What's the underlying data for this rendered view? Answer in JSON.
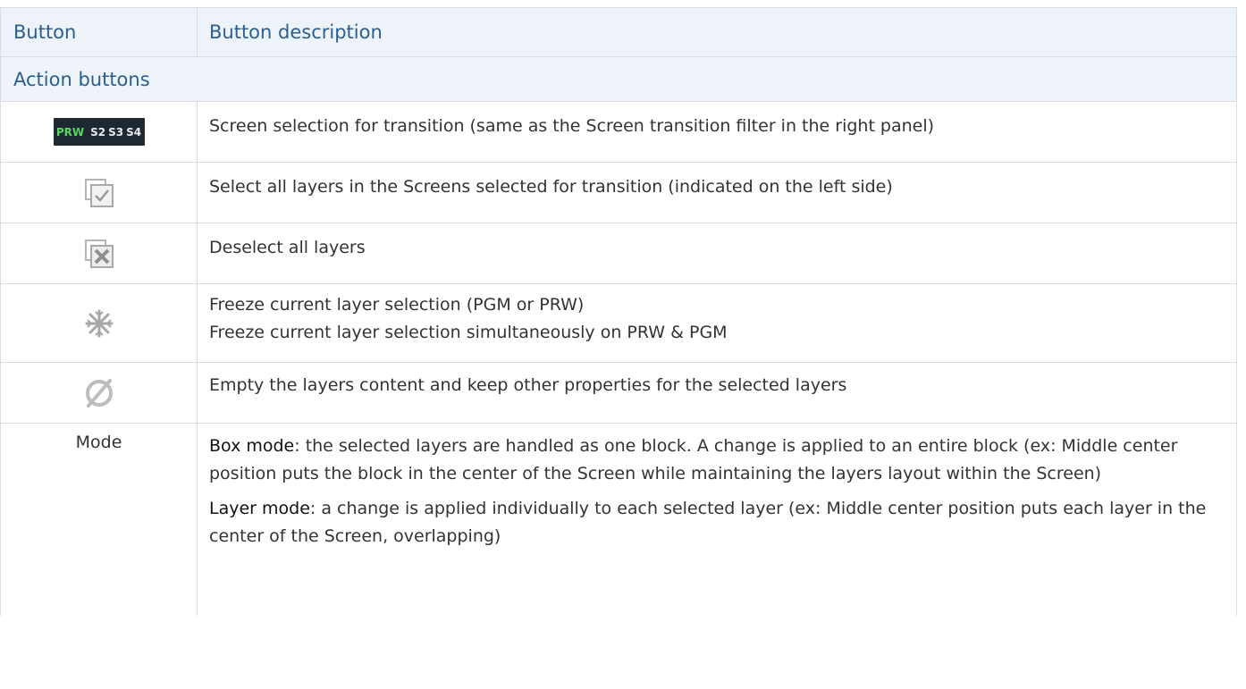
{
  "header": {
    "col1": "Button",
    "col2": "Button description"
  },
  "section": {
    "title": "Action buttons"
  },
  "rows": {
    "screen_sel": {
      "badge": {
        "prw": "PRW",
        "s2": "S2",
        "s3": "S3",
        "s4": "S4"
      },
      "desc": "Screen selection for transition (same as the Screen transition filter in the right panel)"
    },
    "select_all": {
      "icon": "select-all-layers-icon",
      "desc": "Select all layers in the Screens selected for transition (indicated on the left side)"
    },
    "deselect_all": {
      "icon": "deselect-all-layers-icon",
      "desc": "Deselect all layers"
    },
    "freeze": {
      "icon": "snowflake-icon",
      "desc1": "Freeze current layer selection (PGM or PRW)",
      "desc2": "Freeze current layer selection simultaneously on PRW & PGM"
    },
    "empty": {
      "icon": "empty-set-icon",
      "desc": "Empty the layers content and keep other properties for the selected layers"
    },
    "mode": {
      "label": "Mode",
      "box_term": "Box mode",
      "box_desc": ": the selected layers are handled as one block. A change is applied to an entire block (ex: Middle center position puts the block in the center of the Screen while maintaining the layers layout within the Screen)",
      "layer_term": "Layer mode",
      "layer_desc": ": a change is applied individually to each selected layer (ex: Middle center position puts each layer in the center of the Screen, overlapping)"
    }
  },
  "colors": {
    "header_bg": "#edf3f8",
    "header_text": "#2a5f8f",
    "border": "#d6dde3",
    "badge_bg": "#1e2830",
    "badge_green": "#5ad65e",
    "icon_gray": "#a9a9a9"
  }
}
